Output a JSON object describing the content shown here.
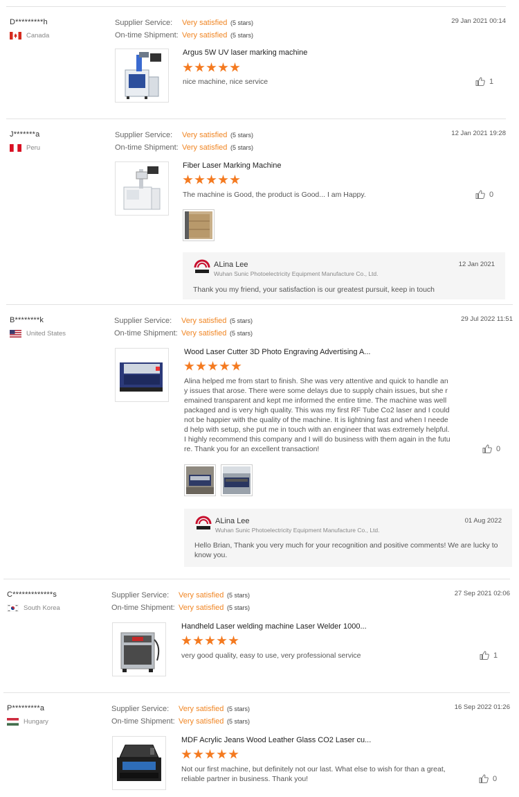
{
  "labels": {
    "supplier_service": "Supplier Service:",
    "on_time_shipment": "On-time Shipment:"
  },
  "colors": {
    "rating_orange": "#f08624",
    "star_orange": "#f47a20",
    "reply_bg": "#f5f5f5"
  },
  "reviews": [
    {
      "buyer": "D*********h",
      "country": "Canada",
      "date": "29 Jan 2021 00:14",
      "supplier_service": "Very satisfied",
      "supplier_stars": "(5 stars)",
      "on_time_shipment": "Very satisfied",
      "shipment_stars": "(5 stars)",
      "product": "Argus 5W UV laser marking machine",
      "rating": 5,
      "comment": "nice machine, nice service",
      "likes": "1"
    },
    {
      "buyer": "J*******a",
      "country": "Peru",
      "date": "12 Jan 2021 19:28",
      "supplier_service": "Very satisfied",
      "supplier_stars": "(5 stars)",
      "on_time_shipment": "Very satisfied",
      "shipment_stars": "(5 stars)",
      "product": "Fiber Laser Marking Machine",
      "rating": 5,
      "comment": "The machine is Good, the product is Good... I am Happy.",
      "likes": "0",
      "reply": {
        "name": "ALina Lee",
        "company": "Wuhan Sunic Photoelectricity Equipment Manufacture Co., Ltd.",
        "date": "12 Jan 2021",
        "text": "Thank you my friend, your satisfaction is our greatest pursuit, keep in touch"
      }
    },
    {
      "buyer": "B********k",
      "country": "United States",
      "date": "29 Jul 2022 11:51",
      "supplier_service": "Very satisfied",
      "supplier_stars": "(5 stars)",
      "on_time_shipment": "Very satisfied",
      "shipment_stars": "(5 stars)",
      "product": "Wood Laser Cutter 3D Photo Engraving Advertising A...",
      "rating": 5,
      "comment": "Alina helped me from start to finish.  She was very attentive and quick to handle any issues that arose. There were some delays due to supply chain issues, but she remained transparent and kept me informed the entire time. The machine was well packaged and is very high quality.  This was my first RF Tube Co2 laser and I could not be happier with the quality of the machine. It is lightning fast and when I needed help with setup, she put me in touch with an engineer that was extremely helpful.  I highly recommend this company and I will do business with them again in the future. Thank you for an excellent transaction!",
      "likes": "0",
      "reply": {
        "name": "ALina Lee",
        "company": "Wuhan Sunic Photoelectricity Equipment Manufacture Co., Ltd.",
        "date": "01 Aug 2022",
        "text": "Hello Brian, Thank you very much for your recognition and positive comments! We are lucky to know you."
      }
    },
    {
      "buyer": "C*************s",
      "country": "South Korea",
      "date": "27 Sep 2021 02:06",
      "supplier_service": "Very satisfied",
      "supplier_stars": "(5 stars)",
      "on_time_shipment": "Very satisfied",
      "shipment_stars": "(5 stars)",
      "product": "Handheld Laser welding machine Laser Welder 1000...",
      "rating": 5,
      "comment": "very good quality, easy to use, very professional service",
      "likes": "1"
    },
    {
      "buyer": "P*********a",
      "country": "Hungary",
      "date": "16 Sep 2022 01:26",
      "supplier_service": "Very satisfied",
      "supplier_stars": "(5 stars)",
      "on_time_shipment": "Very satisfied",
      "shipment_stars": "(5 stars)",
      "product": "MDF Acrylic Jeans Wood Leather Glass CO2 Laser cu...",
      "rating": 5,
      "comment": "Not our first machine, but definitely not our last. What else to wish for than a great, reliable partner in business. Thank you!",
      "likes": "0"
    }
  ]
}
